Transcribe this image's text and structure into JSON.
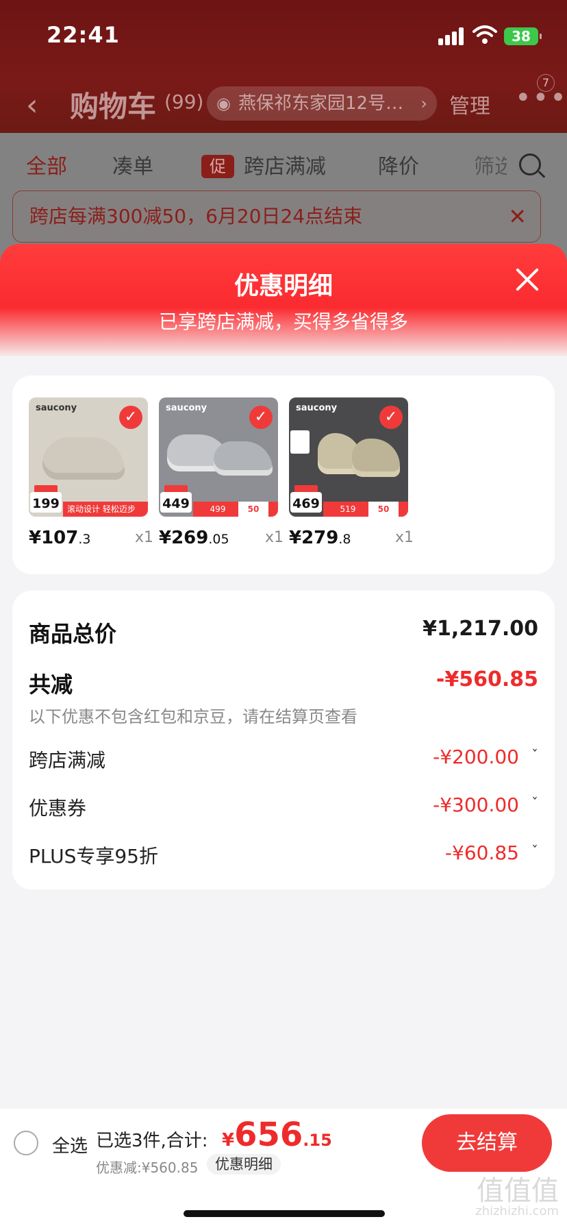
{
  "status_bar": {
    "time": "22:41",
    "battery": "38"
  },
  "nav": {
    "back_icon": "chevron-left-icon",
    "title": "购物车",
    "count": "(99)",
    "address": "燕保祁东家园12号…",
    "manage": "管理",
    "more_badge": "7"
  },
  "tabs": [
    {
      "label": "全部"
    },
    {
      "label": "凑单"
    },
    {
      "label": "跨店满减",
      "tag": "促"
    },
    {
      "label": "降价"
    },
    {
      "label": "筛选"
    }
  ],
  "promo_banner": {
    "text": "跨店每满300减50，6月20日24点结束"
  },
  "sheet": {
    "title": "优惠明细",
    "subtitle": "已享跨店满减，买得多省得多"
  },
  "products": [
    {
      "brand": "saucony",
      "chip": "199",
      "price_int": "¥107",
      "price_dec": ".3",
      "qty": "x1",
      "strip_a": "滚动设计 轻松迈步",
      "strip_b": ""
    },
    {
      "brand": "saucony",
      "chip": "449",
      "price_int": "¥269",
      "price_dec": ".05",
      "qty": "x1",
      "strip_a": "499",
      "strip_b": "50"
    },
    {
      "brand": "saucony",
      "chip": "469",
      "price_int": "¥279",
      "price_dec": ".8",
      "qty": "x1",
      "strip_a": "519",
      "strip_b": "50"
    }
  ],
  "summary": {
    "total_label": "商品总价",
    "total_value": "¥1,217.00",
    "reduce_label": "共减",
    "reduce_value": "-¥560.85",
    "note": "以下优惠不包含红包和京豆，请在结算页查看",
    "items": [
      {
        "label": "跨店满减",
        "value": "-¥200.00"
      },
      {
        "label": "优惠券",
        "value": "-¥300.00"
      },
      {
        "label": "PLUS专享95折",
        "value": "-¥60.85"
      }
    ]
  },
  "bottom": {
    "select_all": "全选",
    "selected": "已选3件,合计:",
    "currency": "¥",
    "total_int": "656",
    "total_dec": ".15",
    "discount": "优惠减:¥560.85",
    "detail": "优惠明细",
    "checkout": "去结算"
  },
  "watermark": {
    "main": "值值值",
    "small": "zhizhizhi.com"
  },
  "colors": {
    "accent": "#f03a3a",
    "price_red": "#ef2a2a"
  }
}
